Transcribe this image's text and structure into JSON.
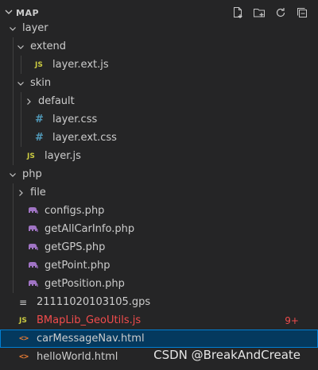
{
  "header": {
    "title": "MAP"
  },
  "toolbar": [
    {
      "name": "new-file-icon"
    },
    {
      "name": "new-folder-icon"
    },
    {
      "name": "refresh-icon"
    },
    {
      "name": "collapse-all-icon"
    }
  ],
  "tree": [
    {
      "label": "layer",
      "type": "folder",
      "depth": 1,
      "expanded": true
    },
    {
      "label": "extend",
      "type": "folder",
      "depth": 2,
      "expanded": true
    },
    {
      "label": "layer.ext.js",
      "type": "js",
      "depth": 3
    },
    {
      "label": "skin",
      "type": "folder",
      "depth": 2,
      "expanded": true
    },
    {
      "label": "default",
      "type": "folder",
      "depth": 3,
      "expanded": false
    },
    {
      "label": "layer.css",
      "type": "css",
      "depth": 3
    },
    {
      "label": "layer.ext.css",
      "type": "css",
      "depth": 3
    },
    {
      "label": "layer.js",
      "type": "js",
      "depth": 2
    },
    {
      "label": "php",
      "type": "folder",
      "depth": 1,
      "expanded": true
    },
    {
      "label": "file",
      "type": "folder",
      "depth": 2,
      "expanded": false
    },
    {
      "label": "configs.php",
      "type": "php",
      "depth": 2
    },
    {
      "label": "getAllCarInfo.php",
      "type": "php",
      "depth": 2
    },
    {
      "label": "getGPS.php",
      "type": "php",
      "depth": 2
    },
    {
      "label": "getPoint.php",
      "type": "php",
      "depth": 2
    },
    {
      "label": "getPosition.php",
      "type": "php",
      "depth": 2
    },
    {
      "label": "21111020103105.gps",
      "type": "text",
      "depth": 1
    },
    {
      "label": "BMapLib_GeoUtils.js",
      "type": "js",
      "depth": 1,
      "error": true,
      "badge": "9+"
    },
    {
      "label": "carMessageNav.html",
      "type": "html",
      "depth": 1,
      "selected": true
    },
    {
      "label": "helloWorld.html",
      "type": "html",
      "depth": 1
    }
  ],
  "watermark": "CSDN @BreakAndCreate",
  "colors": {
    "background": "#252526",
    "selected": "#04395e",
    "focus_border": "#007fd4",
    "error": "#f14c4c"
  }
}
